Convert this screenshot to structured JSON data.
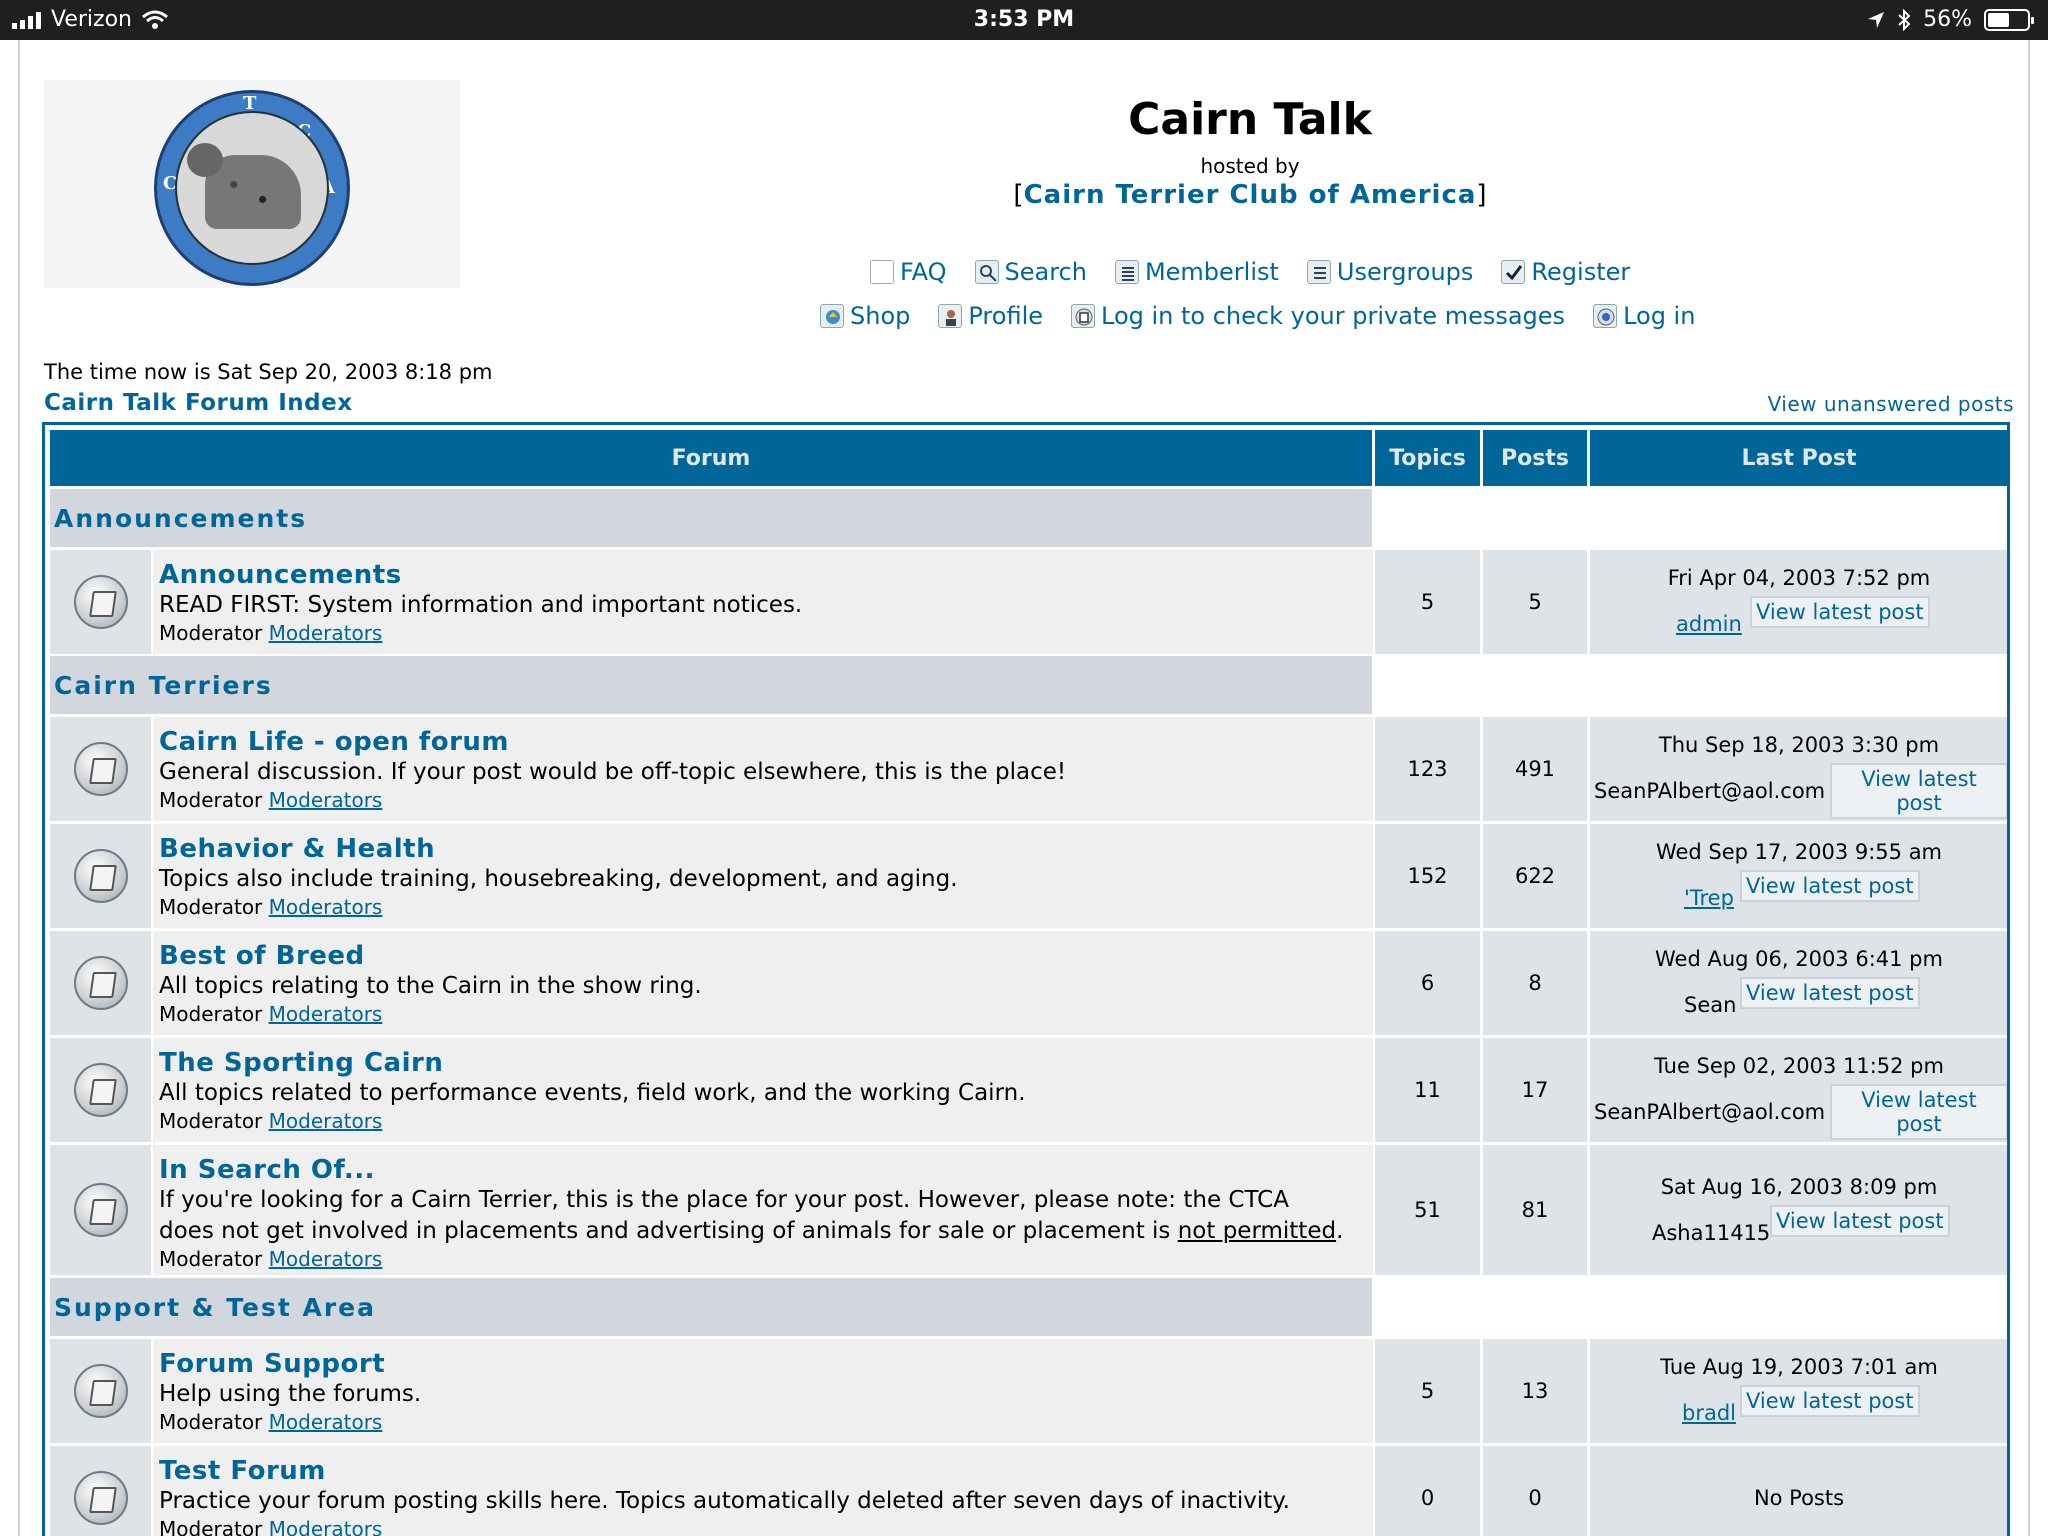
{
  "statusbar": {
    "carrier": "Verizon",
    "time": "3:53 PM",
    "battery": "56%",
    "battery_level": 0.56
  },
  "header": {
    "title": "Cairn Talk",
    "hosted_by": "hosted by",
    "club_open": "[",
    "club_name": "Cairn Terrier Club of America",
    "club_close": "]",
    "logo_letters": [
      "C",
      "T",
      "C",
      "A"
    ]
  },
  "nav": {
    "row1": [
      "FAQ",
      "Search",
      "Memberlist",
      "Usergroups",
      "Register"
    ],
    "row2": [
      "Shop",
      "Profile",
      "Log in to check your private messages",
      "Log in"
    ]
  },
  "time_now": "The time now is Sat Sep 20, 2003 8:18 pm",
  "index_link": "Cairn Talk Forum Index",
  "unanswered_link": "View unanswered posts",
  "table": {
    "headers": {
      "forum": "Forum",
      "topics": "Topics",
      "posts": "Posts",
      "last_post": "Last Post"
    },
    "moderator_label": "Moderator",
    "moderator_link": "Moderators",
    "view_latest": "View latest post",
    "categories": [
      "Announcements",
      "Cairn Terriers",
      "Support & Test Area"
    ],
    "forums": [
      {
        "name": "Announcements",
        "desc": "READ FIRST: System information and important notices.",
        "topics": "5",
        "posts": "5",
        "date": "Fri Apr 04, 2003 7:52 pm",
        "user": "admin"
      },
      {
        "name": "Cairn Life - open forum",
        "desc": "General discussion. If your post would be off-topic elsewhere, this is the place!",
        "topics": "123",
        "posts": "491",
        "date": "Thu Sep 18, 2003 3:30 pm",
        "user": "SeanPAlbert@aol.com"
      },
      {
        "name": "Behavior & Health",
        "desc": "Topics also include training, housebreaking, development, and aging.",
        "topics": "152",
        "posts": "622",
        "date": "Wed Sep 17, 2003 9:55 am",
        "user": "'Trep"
      },
      {
        "name": "Best of Breed",
        "desc": "All topics relating to the Cairn in the show ring.",
        "topics": "6",
        "posts": "8",
        "date": "Wed Aug 06, 2003 6:41 pm",
        "user": "Sean"
      },
      {
        "name": "The Sporting Cairn",
        "desc": "All topics related to performance events, field work, and the working Cairn.",
        "topics": "11",
        "posts": "17",
        "date": "Tue Sep 02, 2003 11:52 pm",
        "user": "SeanPAlbert@aol.com"
      },
      {
        "name": "In Search Of...",
        "desc_a": "If you're looking for a Cairn Terrier, this is the place for your post. However, please note: the CTCA",
        "desc_b": "does not get involved in placements and advertising of animals for sale or placement is ",
        "desc_c": "not permitted",
        "desc_d": ".",
        "topics": "51",
        "posts": "81",
        "date": "Sat Aug 16, 2003 8:09 pm",
        "user": "Asha11415"
      },
      {
        "name": "Forum Support",
        "desc": "Help using the forums.",
        "topics": "5",
        "posts": "13",
        "date": "Tue Aug 19, 2003 7:01 am",
        "user": "bradl"
      },
      {
        "name": "Test Forum",
        "desc": "Practice your forum posting skills here. Topics automatically deleted after seven days of inactivity.",
        "topics": "0",
        "posts": "0",
        "last": "No Posts"
      }
    ]
  }
}
